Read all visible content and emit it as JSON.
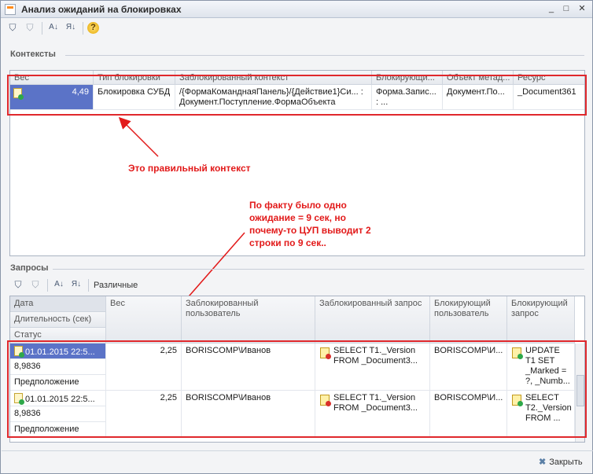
{
  "window": {
    "title": "Анализ ожиданий на блокировках"
  },
  "contexts": {
    "section_title": "Контексты",
    "columns": [
      "Вес",
      "Тип блокировки",
      "Заблокированный контекст",
      "Блокирующи...",
      "Объект метад...",
      "Ресурс"
    ],
    "row": {
      "weight": "4,49",
      "lock_type": "Блокировка СУБД",
      "blocked_context": "/{ФормаКоманднаяПанель}/{Действие1}Си... : Документ.Поступление.ФормаОбъекта",
      "blocking": "Форма.Запис... : ...",
      "metadata_object": "Документ.По...",
      "resource": "_Document361"
    }
  },
  "annotations": {
    "correct_context": "Это правильный контекст",
    "note": "По факту было одно ожидание = 9 сек, но почему-то ЦУП выводит 2 строки по 9 сек.."
  },
  "queries": {
    "section_title": "Запросы",
    "toolbar": {
      "distinct_label": "Различные"
    },
    "first_col_headers": [
      "Дата",
      "Длительность (сек)",
      "Статус"
    ],
    "columns": [
      "Вес",
      "Заблокированный пользователь",
      "Заблокированный запрос",
      "Блокирующий пользователь",
      "Блокирующий запрос"
    ],
    "rows": [
      {
        "date": "01.01.2015 22:5...",
        "duration": "8,9836",
        "status": "Предположение",
        "weight": "2,25",
        "blocked_user": "BORISCOMP\\Иванов",
        "blocked_query": "SELECT T1._Version FROM _Document3...",
        "blocking_user": "BORISCOMP\\И...",
        "blocking_query": "UPDATE T1 SET _Marked = ?, _Numb..."
      },
      {
        "date": "01.01.2015 22:5...",
        "duration": "8,9836",
        "status": "Предположение",
        "weight": "2,25",
        "blocked_user": "BORISCOMP\\Иванов",
        "blocked_query": "SELECT T1._Version FROM _Document3...",
        "blocking_user": "BORISCOMP\\И...",
        "blocking_query": "SELECT T2._Version FROM ..."
      }
    ]
  },
  "footer": {
    "close_label": "Закрыть"
  },
  "colors": {
    "annotation": "#e21a1a",
    "selection": "#5b73c7",
    "frame": "#e0282c"
  }
}
